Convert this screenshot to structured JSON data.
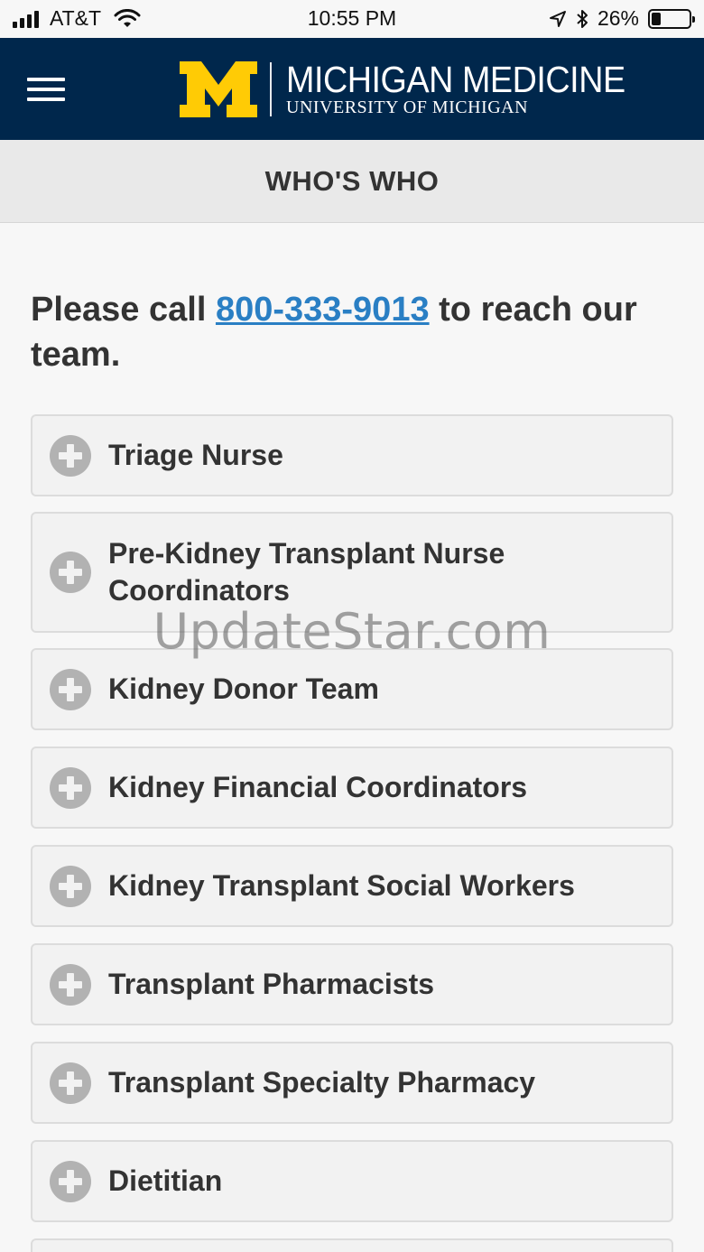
{
  "status_bar": {
    "carrier": "AT&T",
    "time": "10:55 PM",
    "battery_text": "26%",
    "battery_level": 0.26,
    "icons": [
      "signal-icon",
      "wifi-icon",
      "location-icon",
      "bluetooth-icon",
      "battery-icon"
    ]
  },
  "header": {
    "menu_icon": "hamburger-menu-icon",
    "logo_letter": "M",
    "logo_title": "MICHIGAN MEDICINE",
    "logo_subtitle": "UNIVERSITY OF MICHIGAN",
    "colors": {
      "navy": "#00274c",
      "maize": "#ffcb05"
    }
  },
  "page": {
    "title": "WHO'S WHO",
    "intro_prefix": "Please call ",
    "phone": "800-333-9013",
    "intro_suffix": " to reach our team."
  },
  "accordion": [
    {
      "label": "Triage Nurse",
      "icon": "plus-circle-icon"
    },
    {
      "label": "Pre-Kidney Transplant Nurse Coordinators",
      "icon": "plus-circle-icon"
    },
    {
      "label": "Kidney Donor Team",
      "icon": "plus-circle-icon"
    },
    {
      "label": "Kidney Financial Coordinators",
      "icon": "plus-circle-icon"
    },
    {
      "label": "Kidney Transplant Social Workers",
      "icon": "plus-circle-icon"
    },
    {
      "label": "Transplant Pharmacists",
      "icon": "plus-circle-icon"
    },
    {
      "label": "Transplant Specialty Pharmacy",
      "icon": "plus-circle-icon"
    },
    {
      "label": "Dietitian",
      "icon": "plus-circle-icon"
    }
  ],
  "watermark": "UpdateStar.com",
  "colors": {
    "link": "#2a7fc4",
    "text": "#333333",
    "icon": "#b2b2b2"
  }
}
